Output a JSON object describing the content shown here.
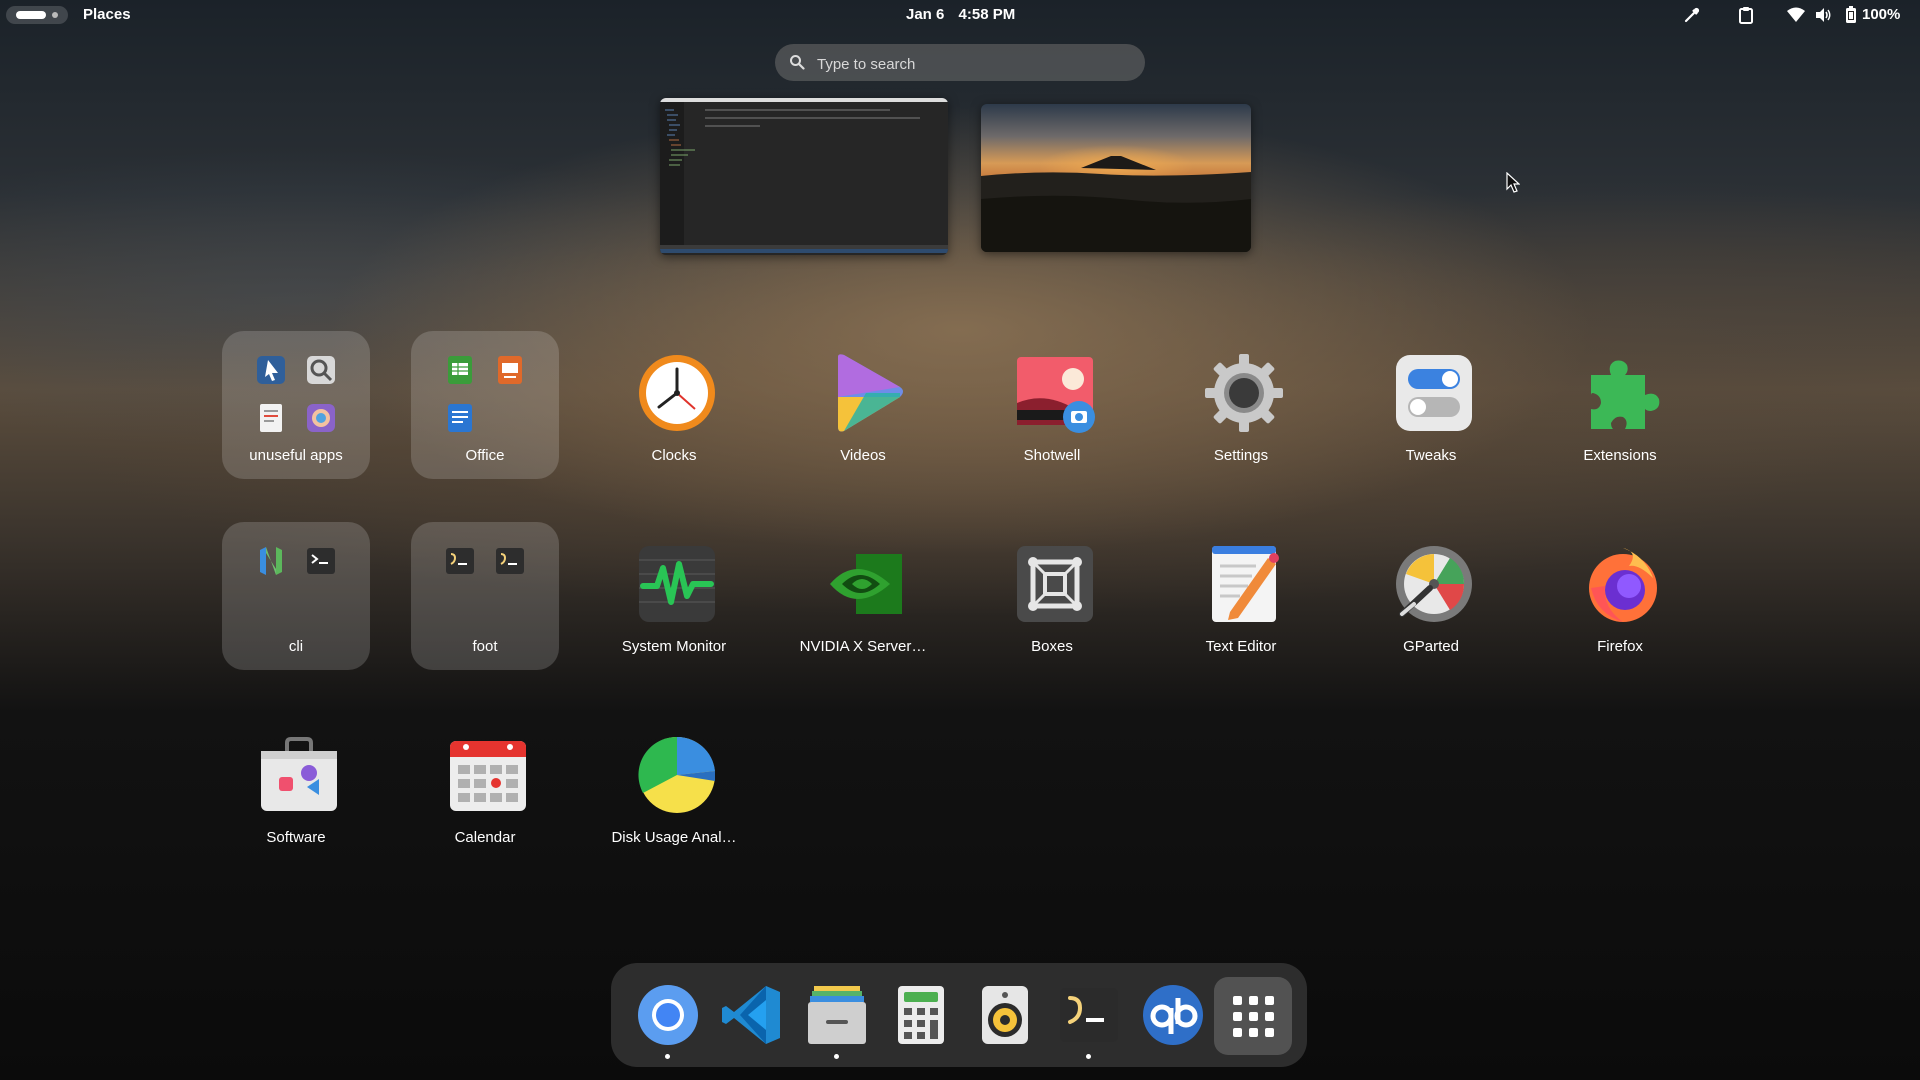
{
  "topbar": {
    "places_label": "Places",
    "date": "Jan 6",
    "time": "4:58 PM",
    "battery_percent": "100%",
    "tray_icons": [
      "color-picker-icon",
      "clipboard-icon",
      "wifi-icon",
      "volume-icon",
      "battery-icon"
    ]
  },
  "search": {
    "placeholder": "Type to search"
  },
  "workspaces": [
    {
      "name": "workspace-1",
      "content": "code-editor"
    },
    {
      "name": "workspace-2",
      "content": "volcano-wallpaper"
    }
  ],
  "apps": [
    {
      "label": "unuseful apps",
      "kind": "folder"
    },
    {
      "label": "Office",
      "kind": "folder"
    },
    {
      "label": "Clocks",
      "kind": "app"
    },
    {
      "label": "Videos",
      "kind": "app"
    },
    {
      "label": "Shotwell",
      "kind": "app"
    },
    {
      "label": "Settings",
      "kind": "app"
    },
    {
      "label": "Tweaks",
      "kind": "app"
    },
    {
      "label": "Extensions",
      "kind": "app"
    },
    {
      "label": "cli",
      "kind": "folder"
    },
    {
      "label": "foot",
      "kind": "folder"
    },
    {
      "label": "System Monitor",
      "kind": "app"
    },
    {
      "label": "NVIDIA X Server…",
      "kind": "app"
    },
    {
      "label": "Boxes",
      "kind": "app"
    },
    {
      "label": "Text Editor",
      "kind": "app"
    },
    {
      "label": "GParted",
      "kind": "app"
    },
    {
      "label": "Firefox",
      "kind": "app"
    },
    {
      "label": "Software",
      "kind": "app"
    },
    {
      "label": "Calendar",
      "kind": "app"
    },
    {
      "label": "Disk Usage Anal…",
      "kind": "app"
    }
  ],
  "dock": [
    {
      "name": "chromium",
      "running": true
    },
    {
      "name": "vscode",
      "running": false
    },
    {
      "name": "files",
      "running": true
    },
    {
      "name": "calculator",
      "running": false
    },
    {
      "name": "rhythmbox",
      "running": false
    },
    {
      "name": "foot-terminal",
      "running": true
    },
    {
      "name": "qbittorrent",
      "running": false
    },
    {
      "name": "show-apps",
      "running": false
    }
  ]
}
